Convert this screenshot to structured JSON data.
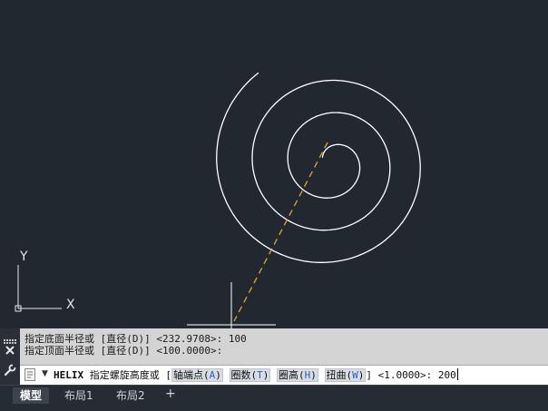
{
  "command_history": [
    "指定底面半径或 [直径(D)] <232.9708>: 100",
    "指定顶面半径或 [直径(D)] <100.0000>:"
  ],
  "command_line": {
    "command": "HELIX",
    "prompt": "指定螺旋高度或 [",
    "options": [
      {
        "label": "轴端点",
        "key": "A"
      },
      {
        "label": "圈数",
        "key": "T"
      },
      {
        "label": "圈高",
        "key": "H"
      },
      {
        "label": "扭曲",
        "key": "W"
      }
    ],
    "default": "<1.0000>:",
    "input": "200"
  },
  "ucs_icon": {
    "x_label": "X",
    "y_label": "Y"
  },
  "layout_tabs": [
    {
      "label": "模型",
      "active": true
    },
    {
      "label": "布局1",
      "active": false
    },
    {
      "label": "布局2",
      "active": false
    }
  ],
  "add_tab_label": "+",
  "colors": {
    "canvas": "#212830",
    "drawing": "#ffffff",
    "rubber_band": "#e8a23a",
    "history_bg": "#d4d4d4",
    "option_key": "#2f5fd0"
  },
  "icons": {
    "close": "close-icon",
    "customize": "wrench-icon",
    "grip": "grip-icon",
    "command": "command-line-icon"
  }
}
